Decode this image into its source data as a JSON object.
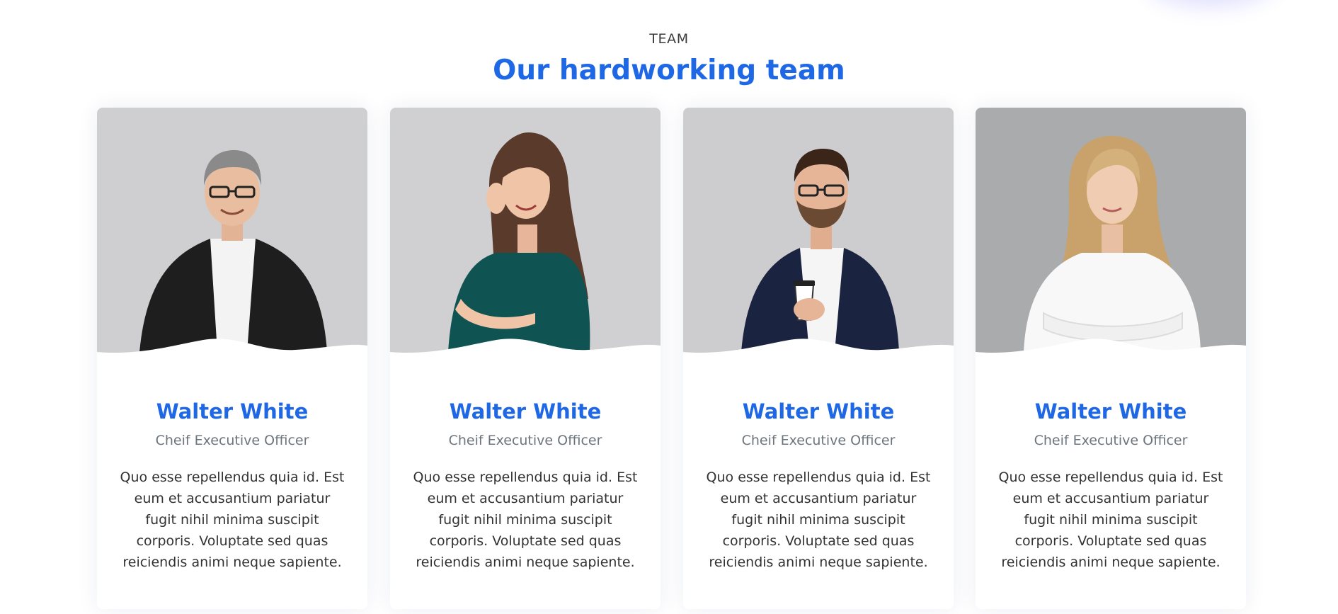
{
  "section": {
    "eyebrow": "TEAM",
    "title": "Our hardworking team"
  },
  "colors": {
    "accent": "#1f68e5",
    "muted": "#6c757d",
    "text": "#333333",
    "photo_bg": "#cfcfd1"
  },
  "team": [
    {
      "name": "Walter White",
      "role": "Cheif Executive Officer",
      "bio": "Quo esse repellendus quia id. Est eum et accusantium pariatur fugit nihil minima suscipit corporis. Voluptate sed quas reiciendis animi neque sapiente.",
      "photo": "man-black-blazer-glasses"
    },
    {
      "name": "Walter White",
      "role": "Cheif Executive Officer",
      "bio": "Quo esse repellendus quia id. Est eum et accusantium pariatur fugit nihil minima suscipit corporis. Voluptate sed quas reiciendis animi neque sapiente.",
      "photo": "woman-teal-top-long-hair"
    },
    {
      "name": "Walter White",
      "role": "Cheif Executive Officer",
      "bio": "Quo esse repellendus quia id. Est eum et accusantium pariatur fugit nihil minima suscipit corporis. Voluptate sed quas reiciendis animi neque sapiente.",
      "photo": "man-navy-blazer-coffee-cup"
    },
    {
      "name": "Walter White",
      "role": "Cheif Executive Officer",
      "bio": "Quo esse repellendus quia id. Est eum et accusantium pariatur fugit nihil minima suscipit corporis. Voluptate sed quas reiciendis animi neque sapiente.",
      "photo": "woman-white-blouse-blonde"
    }
  ]
}
